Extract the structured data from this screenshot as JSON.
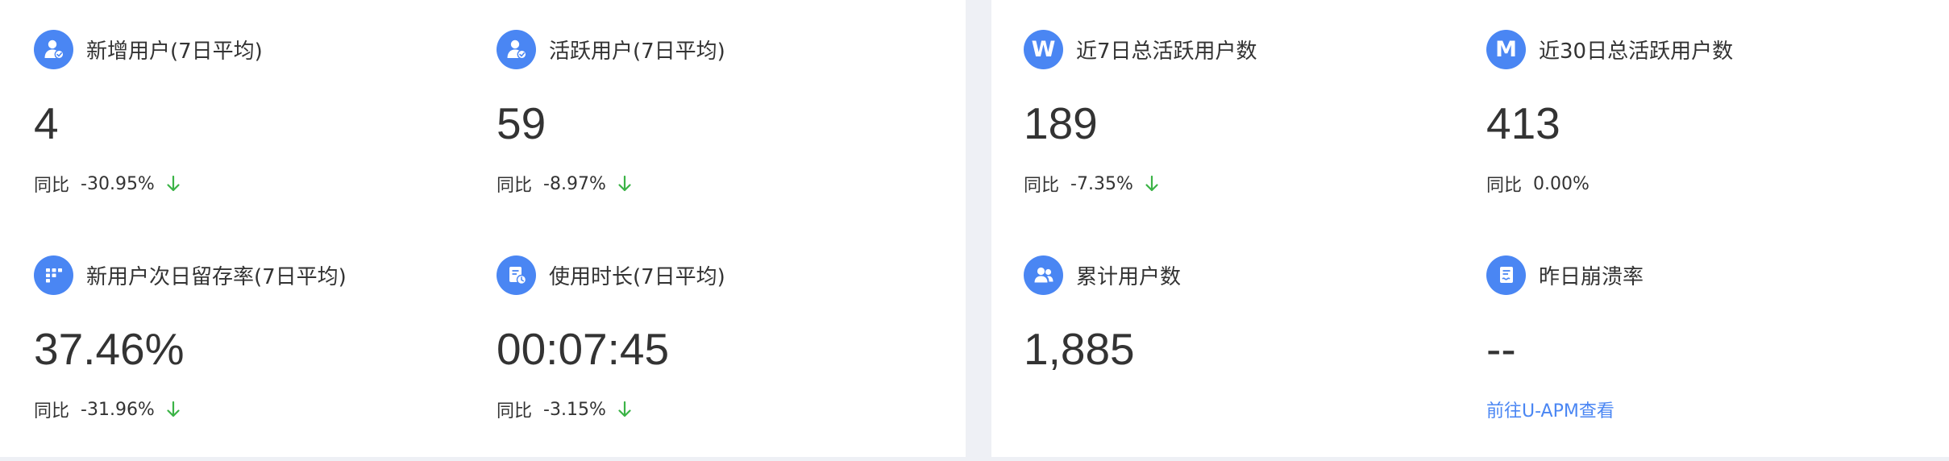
{
  "colors": {
    "accent": "#4a86f3",
    "down": "#3bb346",
    "text": "#333333",
    "link": "#4a86f3",
    "page_bg": "#eef0f5"
  },
  "left_panel": {
    "metrics": [
      {
        "icon": "user-add-icon",
        "title": "新增用户(7日平均)",
        "value": "4",
        "compare_label": "同比",
        "compare_value": "-30.95%",
        "trend": "down"
      },
      {
        "icon": "user-active-icon",
        "title": "活跃用户(7日平均)",
        "value": "59",
        "compare_label": "同比",
        "compare_value": "-8.97%",
        "trend": "down"
      },
      {
        "icon": "retention-grid-icon",
        "title": "新用户次日留存率(7日平均)",
        "value": "37.46%",
        "compare_label": "同比",
        "compare_value": "-31.96%",
        "trend": "down"
      },
      {
        "icon": "duration-clock-icon",
        "title": "使用时长(7日平均)",
        "value": "00:07:45",
        "compare_label": "同比",
        "compare_value": "-3.15%",
        "trend": "down"
      }
    ]
  },
  "right_panel": {
    "metrics": [
      {
        "icon": "week-w-icon",
        "icon_letter": "W",
        "title": "近7日总活跃用户数",
        "value": "189",
        "compare_label": "同比",
        "compare_value": "-7.35%",
        "trend": "down"
      },
      {
        "icon": "month-m-icon",
        "icon_letter": "M",
        "title": "近30日总活跃用户数",
        "value": "413",
        "compare_label": "同比",
        "compare_value": "0.00%",
        "trend": "none"
      },
      {
        "icon": "users-group-icon",
        "title": "累计用户数",
        "value": "1,885"
      },
      {
        "icon": "crash-report-icon",
        "title": "昨日崩溃率",
        "value": "--",
        "link_label": "前往U-APM查看"
      }
    ]
  }
}
